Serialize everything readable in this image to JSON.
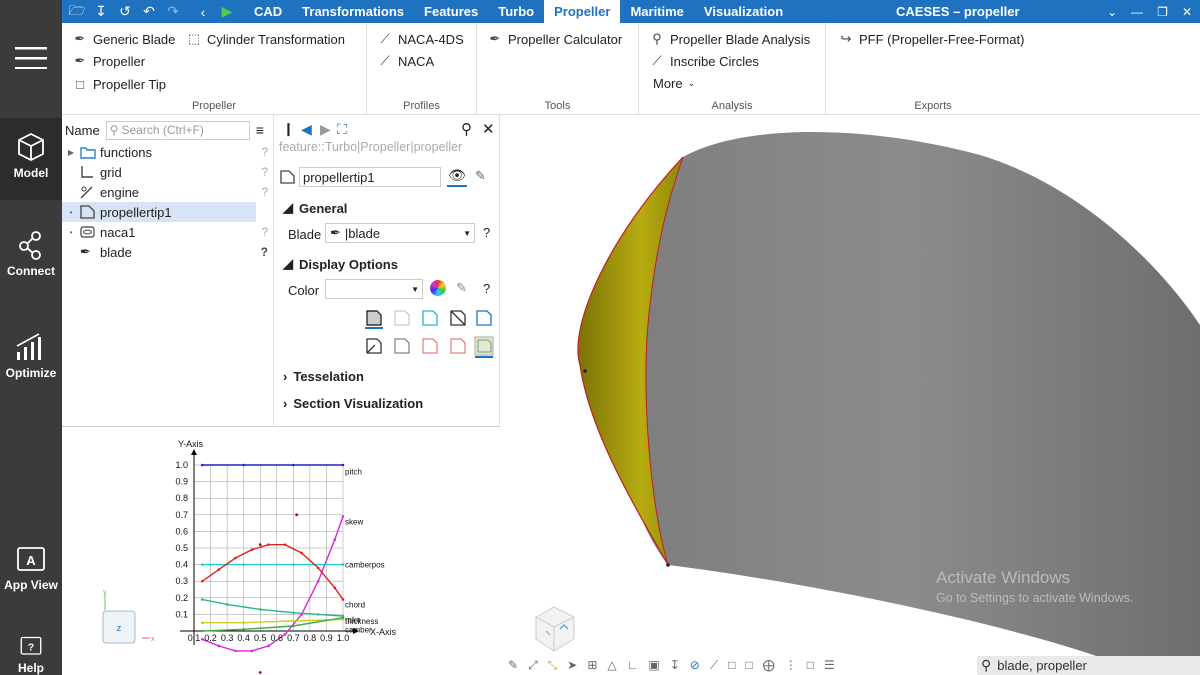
{
  "window": {
    "title": "CAESES – propeller"
  },
  "menu_tabs": [
    {
      "label": "CAD",
      "active": false
    },
    {
      "label": "Transformations",
      "active": false
    },
    {
      "label": "Features",
      "active": false
    },
    {
      "label": "Turbo",
      "active": false
    },
    {
      "label": "Propeller",
      "active": true
    },
    {
      "label": "Maritime",
      "active": false
    },
    {
      "label": "Visualization",
      "active": false
    }
  ],
  "sidebar": {
    "items": [
      {
        "label": "Model",
        "icon": "cube-icon",
        "active": true
      },
      {
        "label": "Connect",
        "icon": "connect-icon",
        "active": false
      },
      {
        "label": "Optimize",
        "icon": "optimize-icon",
        "active": false
      },
      {
        "label": "App View",
        "icon": "app-view-icon",
        "active": false
      },
      {
        "label": "Help",
        "icon": "help-icon",
        "active": false
      }
    ]
  },
  "ribbon": {
    "propeller": {
      "label": "Propeller",
      "generic_blade": "Generic Blade",
      "cylinder_transformation": "Cylinder Transformation",
      "propeller": "Propeller",
      "propeller_tip": "Propeller Tip"
    },
    "profiles": {
      "label": "Profiles",
      "naca4ds": "NACA-4DS",
      "naca": "NACA"
    },
    "tools": {
      "label": "Tools",
      "calculator": "Propeller Calculator"
    },
    "analysis": {
      "label": "Analysis",
      "blade_analysis": "Propeller Blade Analysis",
      "inscribe_circles": "Inscribe Circles",
      "more": "More"
    },
    "exports": {
      "label": "Exports",
      "pff": "PFF (Propeller-Free-Format)"
    }
  },
  "tree": {
    "name_label": "Name",
    "search_placeholder": "Search (Ctrl+F)",
    "items": [
      {
        "label": "functions",
        "icon": "folder-icon",
        "expandable": true
      },
      {
        "label": "grid",
        "icon": "grid-icon",
        "expandable": false
      },
      {
        "label": "engine",
        "icon": "engine-icon",
        "expandable": false
      },
      {
        "label": "propellertip1",
        "icon": "surface-icon",
        "expandable": true,
        "selected": true
      },
      {
        "label": "naca1",
        "icon": "profile-icon",
        "expandable": true
      },
      {
        "label": "blade",
        "icon": "blade-icon",
        "expandable": false
      }
    ]
  },
  "properties": {
    "path": "feature::Turbo|Propeller|propeller",
    "name": "propellertip1",
    "general": "General",
    "blade_label": "Blade",
    "blade_value": "|blade",
    "display_options": "Display Options",
    "color_label": "Color",
    "tesselation": "Tesselation",
    "section_visualization": "Section Visualization"
  },
  "chart_data": {
    "type": "line",
    "title": "",
    "xlabel": "X-Axis",
    "ylabel": "Y-Axis",
    "xlim": [
      0.1,
      1.0
    ],
    "ylim": [
      0.0,
      1.0
    ],
    "xticks": [
      "0.1",
      "0.2",
      "0.3",
      "0.4",
      "0.5",
      "0.6",
      "0.7",
      "0.8",
      "0.9",
      "1.0"
    ],
    "yticks": [
      "0.1",
      "0.2",
      "0.3",
      "0.4",
      "0.5",
      "0.6",
      "0.7",
      "0.8",
      "0.9",
      "1.0"
    ],
    "grid": true,
    "series": [
      {
        "name": "pitch",
        "color": "#2222cc",
        "x": [
          0.15,
          0.4,
          0.7,
          1.0
        ],
        "y": [
          1.0,
          1.0,
          1.0,
          1.0
        ],
        "label_y": 0.96
      },
      {
        "name": "skew",
        "color": "#dd22dd",
        "x": [
          0.15,
          0.25,
          0.35,
          0.45,
          0.55,
          0.65,
          0.75,
          0.85,
          0.95,
          1.0
        ],
        "y": [
          -0.05,
          -0.09,
          -0.12,
          -0.12,
          -0.09,
          -0.02,
          0.1,
          0.3,
          0.55,
          0.69
        ],
        "label_y": 0.66
      },
      {
        "name": "camberpos",
        "color": "#22cccc",
        "x": [
          0.15,
          0.4,
          0.7,
          1.0
        ],
        "y": [
          0.4,
          0.4,
          0.4,
          0.4
        ],
        "label_y": 0.4
      },
      {
        "name": "chord",
        "color": "#dd2222",
        "x": [
          0.15,
          0.25,
          0.35,
          0.45,
          0.55,
          0.65,
          0.75,
          0.85,
          0.95,
          1.0
        ],
        "y": [
          0.3,
          0.37,
          0.44,
          0.49,
          0.52,
          0.52,
          0.47,
          0.38,
          0.26,
          0.19
        ],
        "label_y": 0.16
      },
      {
        "name": "rake",
        "color": "#22bb88",
        "x": [
          0.15,
          0.3,
          0.5,
          0.7,
          0.85,
          1.0
        ],
        "y": [
          0.19,
          0.16,
          0.13,
          0.11,
          0.1,
          0.09
        ],
        "label_y": 0.07
      },
      {
        "name": "thickness",
        "color": "#cccc22",
        "x": [
          0.15,
          0.4,
          0.7,
          1.0
        ],
        "y": [
          0.05,
          0.05,
          0.06,
          0.07
        ],
        "label_y": 0.06
      },
      {
        "name": "camber",
        "color": "#44aa44",
        "x": [
          0.15,
          0.4,
          0.7,
          1.0
        ],
        "y": [
          0.0,
          0.01,
          0.03,
          0.08
        ],
        "label_y": 0.01
      }
    ],
    "markers": [
      {
        "x": 0.5,
        "y": 0.52
      },
      {
        "x": 0.72,
        "y": 0.7
      },
      {
        "x": 0.5,
        "y": -0.25
      }
    ]
  },
  "viewport": {
    "watermark_title": "Activate Windows",
    "watermark_sub": "Go to Settings to activate Windows.",
    "search_value": "blade, propeller"
  },
  "colors": {
    "accent": "#1f72bf",
    "sidebar": "#3b3b3b",
    "tip": "#b8ac11"
  }
}
